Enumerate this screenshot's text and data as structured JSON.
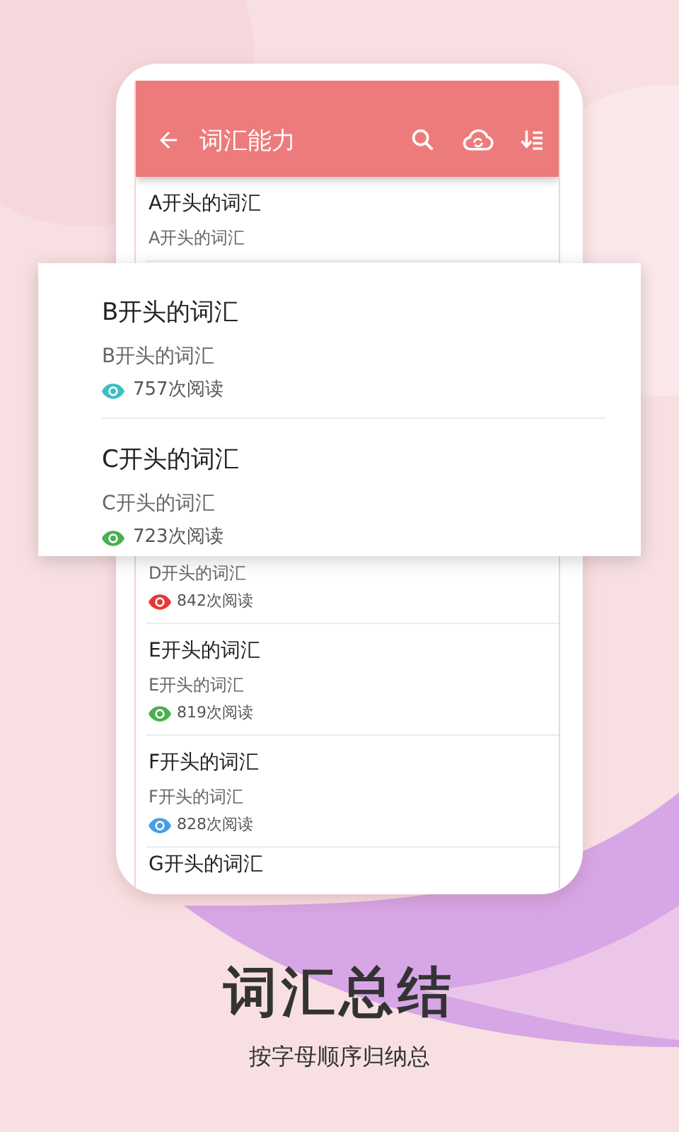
{
  "app_bar": {
    "title": "词汇能力"
  },
  "list_above": [
    {
      "title": "A开头的词汇",
      "subtitle": "A开头的词汇"
    }
  ],
  "list_below": [
    {
      "subtitle": "D开头的词汇",
      "count": "842次阅读",
      "color": "#e53935"
    },
    {
      "title": "E开头的词汇",
      "subtitle": "E开头的词汇",
      "count": "819次阅读",
      "color": "#4caf50"
    },
    {
      "title": "F开头的词汇",
      "subtitle": "F开头的词汇",
      "count": "828次阅读",
      "color": "#4a9ee0"
    },
    {
      "title": "G开头的词汇"
    }
  ],
  "popup": [
    {
      "title": "B开头的词汇",
      "subtitle": "B开头的词汇",
      "count": "757次阅读",
      "color": "#3bbfc4"
    },
    {
      "title": "C开头的词汇",
      "subtitle": "C开头的词汇",
      "count": "723次阅读",
      "color": "#4caf50"
    }
  ],
  "heading": "词汇总结",
  "subheading": "按字母顺序归纳总"
}
